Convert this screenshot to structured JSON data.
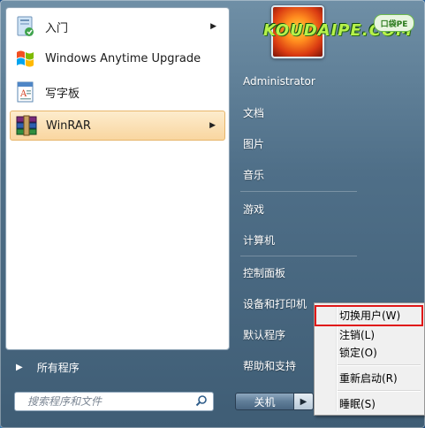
{
  "programs": [
    {
      "label": "入门",
      "icon": "getting-started-icon",
      "has_arrow": true
    },
    {
      "label": "Windows Anytime Upgrade",
      "icon": "windows-flag-icon",
      "has_arrow": false
    },
    {
      "label": "写字板",
      "icon": "wordpad-icon",
      "has_arrow": false
    },
    {
      "label": "WinRAR",
      "icon": "winrar-icon",
      "has_arrow": true,
      "highlighted": true
    }
  ],
  "all_programs": "所有程序",
  "search": {
    "placeholder": "搜索程序和文件"
  },
  "right_items": [
    "Administrator",
    "文档",
    "图片",
    "音乐",
    "游戏",
    "计算机",
    "控制面板",
    "设备和打印机",
    "默认程序",
    "帮助和支持"
  ],
  "shutdown_label": "关机",
  "context_menu": [
    {
      "label": "切换用户(W)",
      "highlighted": true
    },
    {
      "label": "注销(L)"
    },
    {
      "label": "锁定(O)"
    },
    {
      "label": "重新启动(R)"
    },
    {
      "label": "睡眠(S)"
    }
  ],
  "watermark": {
    "text": "KOUDAIPE.COM",
    "logo": "口袋PE"
  },
  "colors": {
    "highlight": "#f9d6a0",
    "annotation_box": "#e01818",
    "watermark": "#b6f24a"
  }
}
